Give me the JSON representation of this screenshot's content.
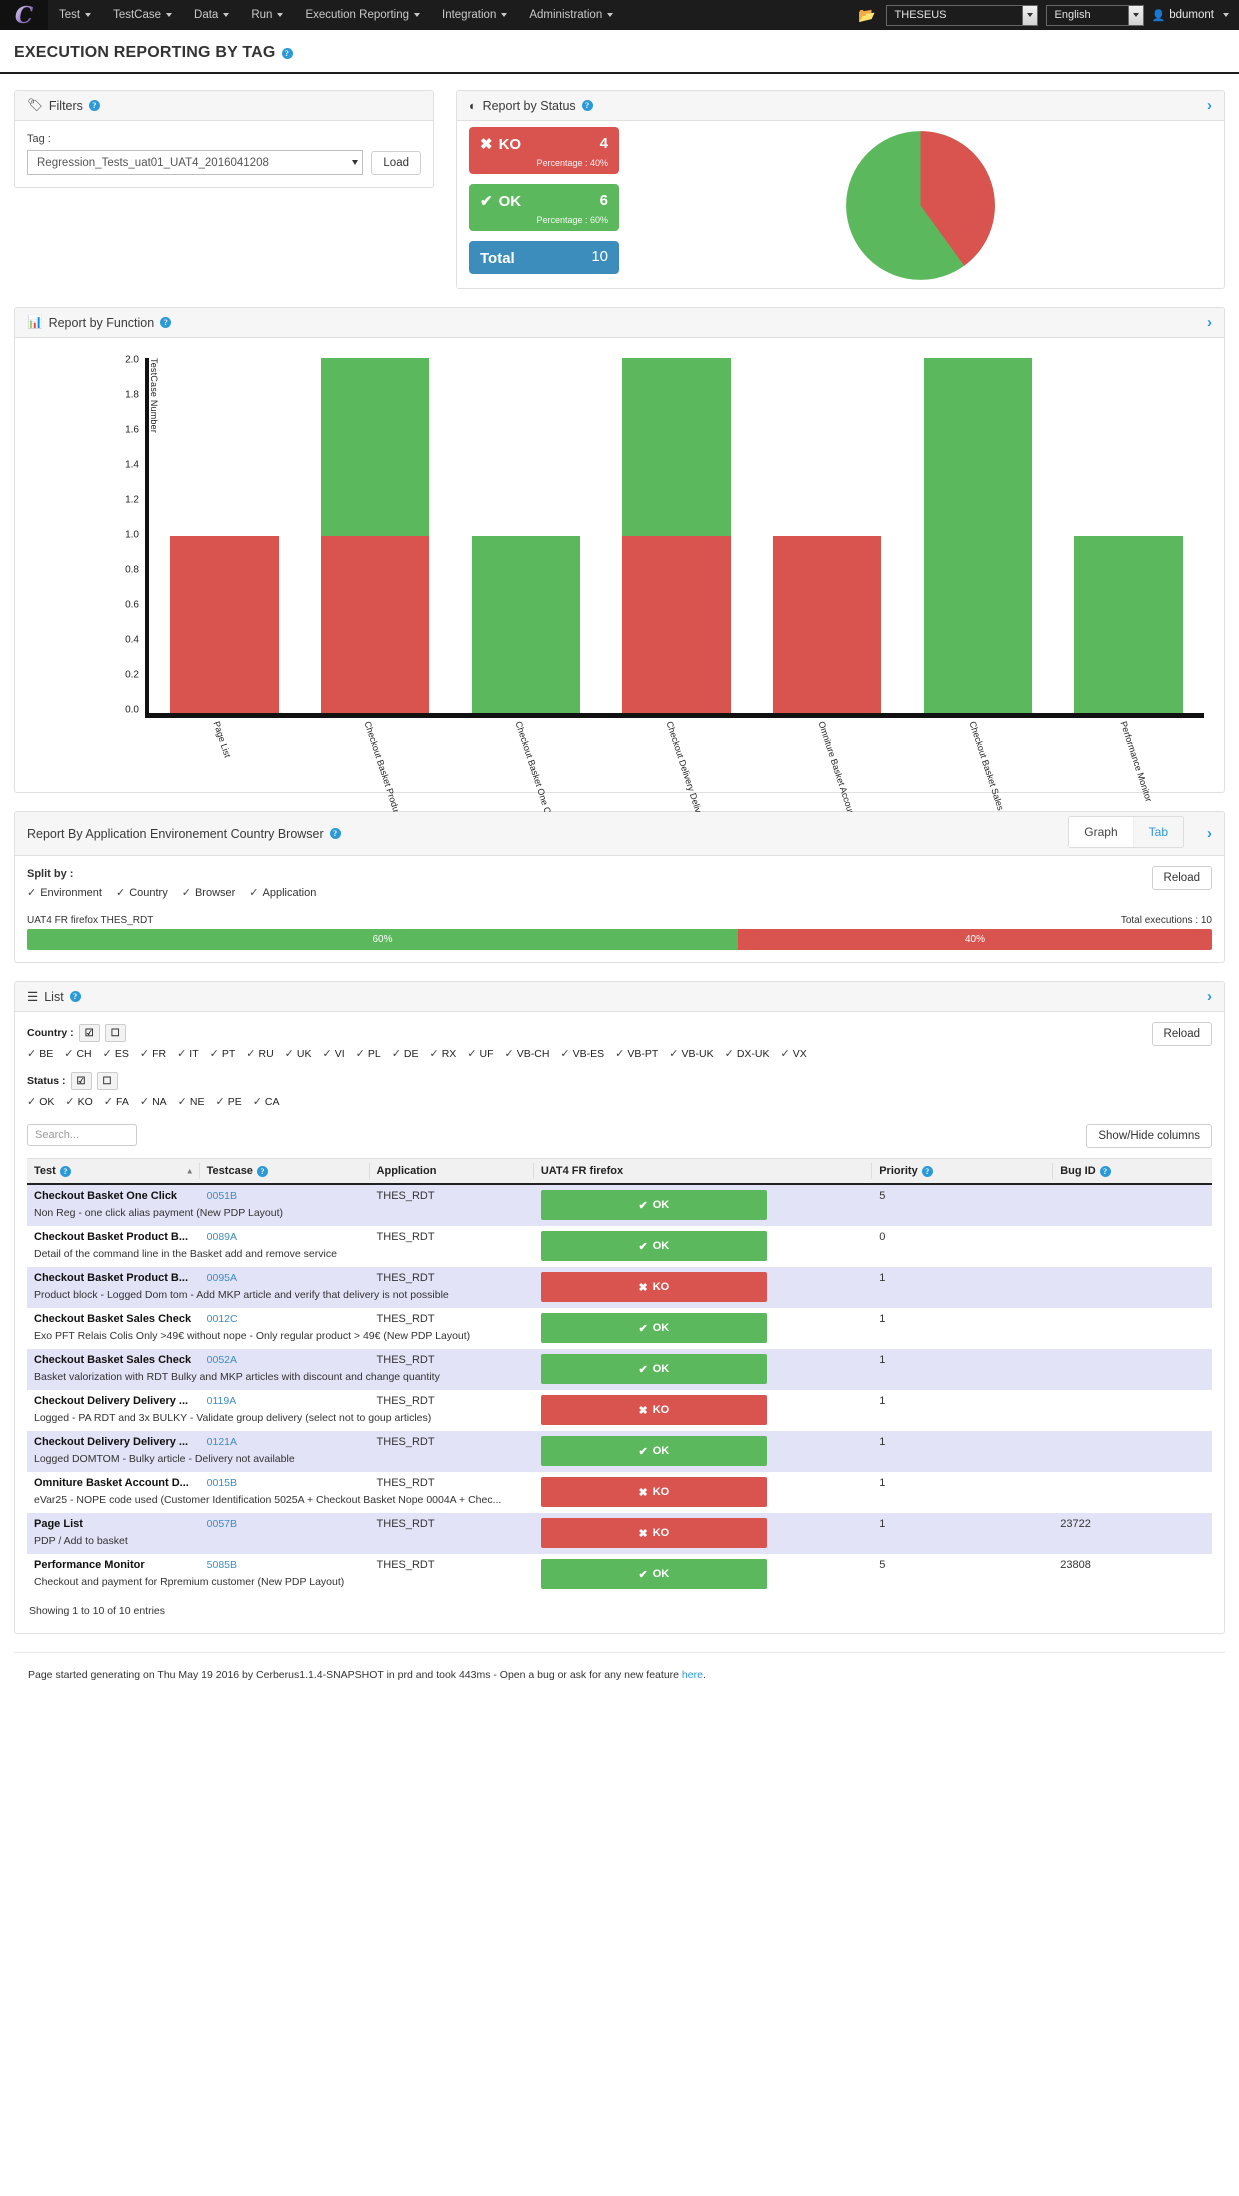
{
  "navbar": {
    "brand": "C",
    "items": [
      {
        "label": "Test"
      },
      {
        "label": "TestCase"
      },
      {
        "label": "Data"
      },
      {
        "label": "Run"
      },
      {
        "label": "Execution Reporting"
      },
      {
        "label": "Integration"
      },
      {
        "label": "Administration"
      }
    ],
    "project": "THESEUS",
    "language": "English",
    "user": "bdumont"
  },
  "page": {
    "title": "EXECUTION REPORTING BY TAG"
  },
  "filters": {
    "panel_title": "Filters",
    "tag_label": "Tag :",
    "tag_value": "Regression_Tests_uat01_UAT4_2016041208",
    "load_label": "Load"
  },
  "status": {
    "panel_title": "Report by Status",
    "ko": {
      "label": "KO",
      "count": "4",
      "percentage": "Percentage : 40%"
    },
    "ok": {
      "label": "OK",
      "count": "6",
      "percentage": "Percentage : 60%"
    },
    "total": {
      "label": "Total",
      "count": "10"
    }
  },
  "function": {
    "panel_title": "Report by Function"
  },
  "appenv": {
    "panel_title": "Report By Application Environement Country Browser",
    "tab_graph": "Graph",
    "tab_tab": "Tab",
    "split_label": "Split by :",
    "splits": [
      "Environment",
      "Country",
      "Browser",
      "Application"
    ],
    "reload_label": "Reload",
    "bar_label": "UAT4 FR firefox THES_RDT",
    "total_exec": "Total executions : 10",
    "ok_pct": "60%",
    "ko_pct": "40%"
  },
  "list": {
    "panel_title": "List",
    "country_label": "Country :",
    "countries": [
      "BE",
      "CH",
      "ES",
      "FR",
      "IT",
      "PT",
      "RU",
      "UK",
      "VI",
      "PL",
      "DE",
      "RX",
      "UF",
      "VB-CH",
      "VB-ES",
      "VB-PT",
      "VB-UK",
      "DX-UK",
      "VX"
    ],
    "status_label": "Status :",
    "statuses": [
      "OK",
      "KO",
      "FA",
      "NA",
      "NE",
      "PE",
      "CA"
    ],
    "reload_label": "Reload",
    "search_placeholder": "Search...",
    "showhide_label": "Show/Hide columns",
    "columns": [
      "Test",
      "Testcase",
      "Application",
      "UAT4 FR firefox",
      "Priority",
      "Bug ID"
    ],
    "rows": [
      {
        "test": "Checkout Basket One Click",
        "testcase": "0051B",
        "application": "THES_RDT",
        "status": "OK",
        "priority": "5",
        "bug": "",
        "description": "Non Reg - one click alias payment (New PDP Layout)"
      },
      {
        "test": "Checkout Basket Product B...",
        "testcase": "0089A",
        "application": "THES_RDT",
        "status": "OK",
        "priority": "0",
        "bug": "",
        "description": "Detail of the command line in the Basket add and remove service"
      },
      {
        "test": "Checkout Basket Product B...",
        "testcase": "0095A",
        "application": "THES_RDT",
        "status": "KO",
        "priority": "1",
        "bug": "",
        "description": "Product block - Logged Dom tom - Add MKP article and verify that delivery is not possible"
      },
      {
        "test": "Checkout Basket Sales Check",
        "testcase": "0012C",
        "application": "THES_RDT",
        "status": "OK",
        "priority": "1",
        "bug": "",
        "description": "Exo PFT Relais Colis Only >49€ without nope - Only regular product > 49€ (New PDP Layout)"
      },
      {
        "test": "Checkout Basket Sales Check",
        "testcase": "0052A",
        "application": "THES_RDT",
        "status": "OK",
        "priority": "1",
        "bug": "",
        "description": "Basket valorization with RDT Bulky and MKP articles with discount and change quantity"
      },
      {
        "test": "Checkout Delivery Delivery ...",
        "testcase": "0119A",
        "application": "THES_RDT",
        "status": "KO",
        "priority": "1",
        "bug": "",
        "description": "Logged - PA RDT and 3x BULKY - Validate group delivery (select not to goup articles)"
      },
      {
        "test": "Checkout Delivery Delivery ...",
        "testcase": "0121A",
        "application": "THES_RDT",
        "status": "OK",
        "priority": "1",
        "bug": "",
        "description": "Logged DOMTOM - Bulky article - Delivery not available"
      },
      {
        "test": "Omniture Basket Account D...",
        "testcase": "0015B",
        "application": "THES_RDT",
        "status": "KO",
        "priority": "1",
        "bug": "",
        "description": "eVar25 - NOPE code used (Customer Identification 5025A + Checkout Basket Nope 0004A + Chec..."
      },
      {
        "test": "Page List",
        "testcase": "0057B",
        "application": "THES_RDT",
        "status": "KO",
        "priority": "1",
        "bug": "23722",
        "description": "PDP / Add to basket"
      },
      {
        "test": "Performance Monitor",
        "testcase": "5085B",
        "application": "THES_RDT",
        "status": "OK",
        "priority": "5",
        "bug": "23808",
        "description": "Checkout and payment for Rpremium customer (New PDP Layout)"
      }
    ],
    "showing": "Showing 1 to 10 of 10 entries",
    "status_ok_label": "OK",
    "status_ko_label": "KO"
  },
  "footer": {
    "text": "Page started generating on Thu May 19 2016 by Cerberus1.1.4-SNAPSHOT in prd and took 443ms - Open a bug or ask for any new feature ",
    "link": "here",
    "period": "."
  },
  "colors": {
    "ok": "#5cb85c",
    "ko": "#d9534f",
    "total": "#3c8dbc",
    "accent": "#2b9ad6"
  },
  "chart_data": [
    {
      "type": "pie",
      "title": "Report by Status",
      "labels": [
        "KO",
        "OK"
      ],
      "values": [
        40,
        60
      ],
      "counts": [
        4,
        6
      ],
      "colors": [
        "#d9534f",
        "#5cb85c"
      ],
      "legend": "none",
      "start_angle_deg": 0,
      "direction": "clockwise"
    },
    {
      "type": "bar",
      "title": "Report by Function",
      "stacked": true,
      "categories": [
        "Page List",
        "Checkout Basket Product Block",
        "Checkout Basket One Click",
        "Checkout Delivery Delivery Method",
        "Omniture Basket Account Delivery",
        "Checkout Basket Sales Check",
        "Performance Monitor"
      ],
      "series": [
        {
          "name": "KO",
          "color": "#d9534f",
          "values": [
            1,
            1,
            0,
            1,
            1,
            0,
            0
          ]
        },
        {
          "name": "OK",
          "color": "#5cb85c",
          "values": [
            0,
            1,
            1,
            1,
            0,
            2,
            1
          ]
        }
      ],
      "ylabel": "TestCase Number",
      "xlabel": "",
      "ylim": [
        0,
        2
      ],
      "yticks": [
        "0.0",
        "0.2",
        "0.4",
        "0.6",
        "0.8",
        "1.0",
        "1.2",
        "1.4",
        "1.6",
        "1.8",
        "2.0"
      ],
      "grid": false,
      "legend": "none"
    },
    {
      "type": "bar",
      "orientation": "horizontal-stacked",
      "title": "UAT4 FR firefox THES_RDT",
      "categories": [
        "UAT4 FR firefox THES_RDT"
      ],
      "series": [
        {
          "name": "OK",
          "color": "#5cb85c",
          "values": [
            60
          ]
        },
        {
          "name": "KO",
          "color": "#d9534f",
          "values": [
            40
          ]
        }
      ],
      "annotation": "Total executions : 10",
      "ylim": [
        0,
        100
      ],
      "legend": "none"
    }
  ]
}
